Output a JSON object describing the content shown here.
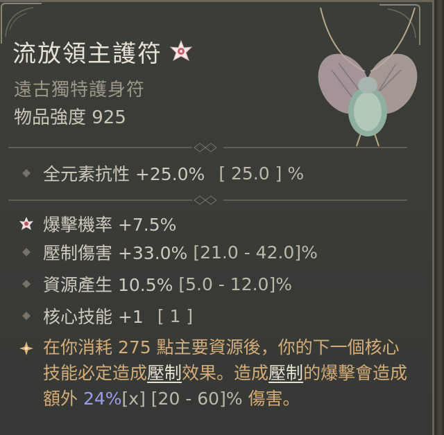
{
  "item": {
    "name": "流放領主護符",
    "type": "遠古獨特護身符",
    "power": "物品強度 925"
  },
  "stats": [
    {
      "label": "全元素抗性 +25.0%",
      "range": "[ 25.0 ] %",
      "bullet": "diamond"
    },
    {
      "label": "爆擊機率 +7.5%",
      "range": "",
      "bullet": "star"
    },
    {
      "label": "壓制傷害 +33.0%",
      "range": "[21.0 - 42.0]%",
      "bullet": "diamond"
    },
    {
      "label": "資源產生 10.5%",
      "range": "[5.0 - 12.0]%",
      "bullet": "diamond"
    },
    {
      "label": "核心技能 +1",
      "range": "[ 1 ]",
      "bullet": "diamond"
    }
  ],
  "aspect": {
    "p1": "在你消耗 275 點主要資源後，你的下一個核心技能必定造成",
    "u1": "壓制",
    "p2": "效果。造成",
    "u2": "壓制",
    "p3": "的爆擊會造成額外 ",
    "value": "24%",
    "tag": "[x]",
    "range": " [20 - 60]%",
    "p4": " 傷害。"
  },
  "colors": {
    "title": "#e8e3d6",
    "subtitle": "#9d9888",
    "stat": "#cfcabd",
    "aspect": "#d4ad78",
    "highlight": "#9c9cf0"
  },
  "icons": [
    "unique-star-icon",
    "amulet-beetle-icon",
    "diamond-bullet-icon",
    "star-bullet-icon",
    "aspect-bullet-icon"
  ]
}
